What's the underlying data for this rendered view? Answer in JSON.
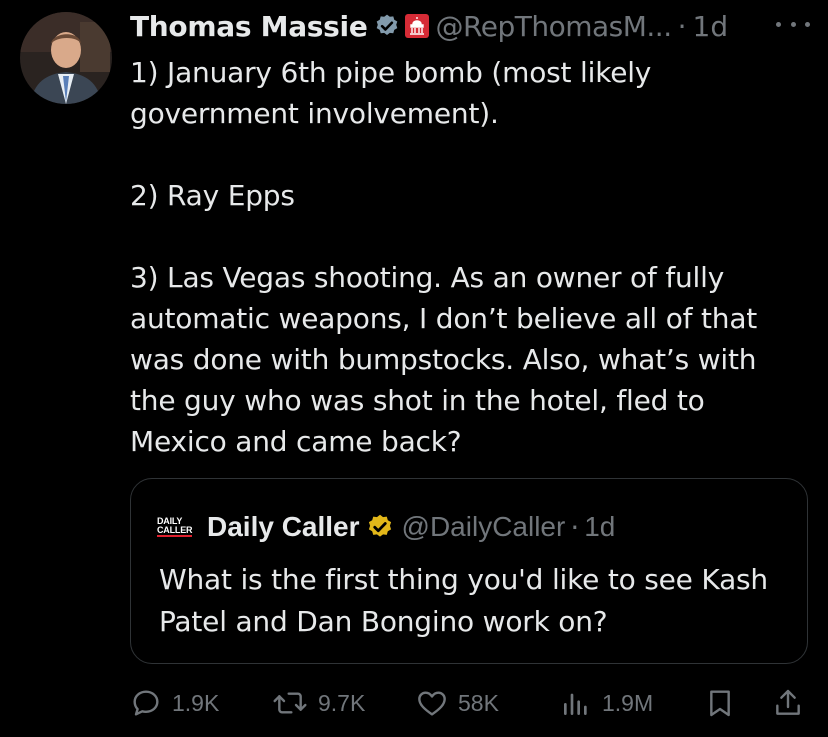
{
  "author": {
    "name": "Thomas Massie",
    "handle": "@RepThomasM...",
    "separator": "·",
    "time": "1d",
    "icons": [
      "verified-badge-icon",
      "us-capitol-affiliation-icon",
      "more-options-icon"
    ]
  },
  "post": {
    "paragraphs": [
      "1) January 6th pipe bomb (most likely government involvement).",
      "2) Ray Epps",
      "3) Las Vegas shooting. As an owner of fully automatic weapons, I don’t believe all of that was done with bumpstocks. Also, what’s with the guy who was shot in the hotel, fled to Mexico and came back?"
    ]
  },
  "quoted": {
    "logo_line1": "DAILY",
    "logo_line2": "CALLER",
    "name": "Daily Caller",
    "handle": "@DailyCaller",
    "separator": "·",
    "time": "1d",
    "text": "What is the first thing you'd like to see Kash Patel and Dan Bongino work on?"
  },
  "actions": {
    "replies": "1.9K",
    "reposts": "9.7K",
    "likes": "58K",
    "views": "1.9M"
  },
  "colors": {
    "background": "#000000",
    "text": "#e7e9ea",
    "secondary": "#71767b",
    "border": "#2f3336",
    "verified_blue": "#829aab",
    "verified_gold": "#e2b719"
  }
}
